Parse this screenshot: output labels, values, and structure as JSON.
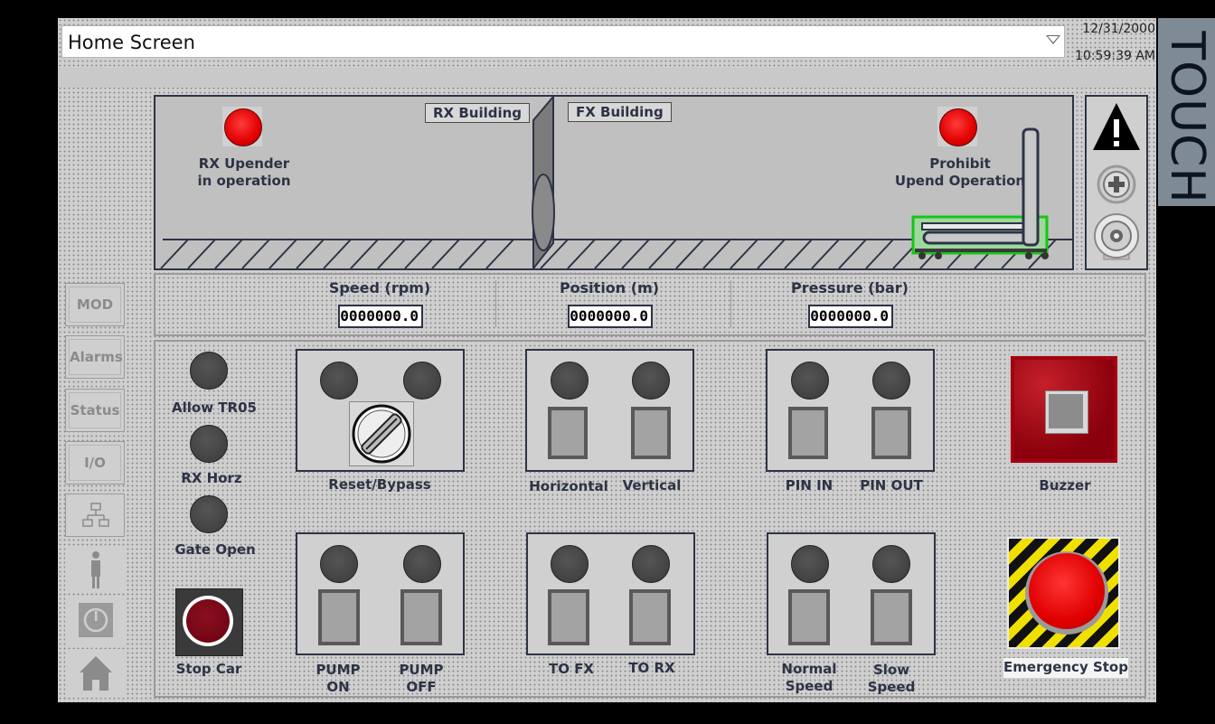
{
  "header": {
    "title": "Home Screen",
    "date": "12/31/2000",
    "time": "10:59:39 AM",
    "brand": "TOUCH"
  },
  "scene": {
    "rx_building": "RX Building",
    "fx_building": "FX Building",
    "rx_upender": "RX Upender\nin operation",
    "prohibit_upend": "Prohibit\nUpend Operation"
  },
  "readouts": [
    {
      "label": "Speed (rpm)",
      "value": "0000000.0"
    },
    {
      "label": "Position (m)",
      "value": "0000000.0"
    },
    {
      "label": "Pressure (bar)",
      "value": "0000000.0"
    }
  ],
  "nav": [
    "MOD",
    "Alarms",
    "Status",
    "I/O"
  ],
  "controls": {
    "allow_tr05": "Allow TR05",
    "rx_horz": "RX Horz",
    "gate_open": "Gate Open",
    "stop_car": "Stop Car",
    "reset_bypass": "Reset/Bypass",
    "horizontal": "Horizontal",
    "vertical": "Vertical",
    "pin_in": "PIN IN",
    "pin_out": "PIN OUT",
    "buzzer": "Buzzer",
    "pump_on": "PUMP\nON",
    "pump_off": "PUMP\nOFF",
    "to_fx": "TO FX",
    "to_rx": "TO RX",
    "normal_speed": "Normal\nSpeed",
    "slow_speed": "Slow\nSpeed",
    "emergency_stop": "Emergency Stop"
  },
  "colors": {
    "lamp_on": "#e00000",
    "lamp_off": "#3f3f3f",
    "panel": "#cfcfcf",
    "frame": "#2d3345"
  }
}
